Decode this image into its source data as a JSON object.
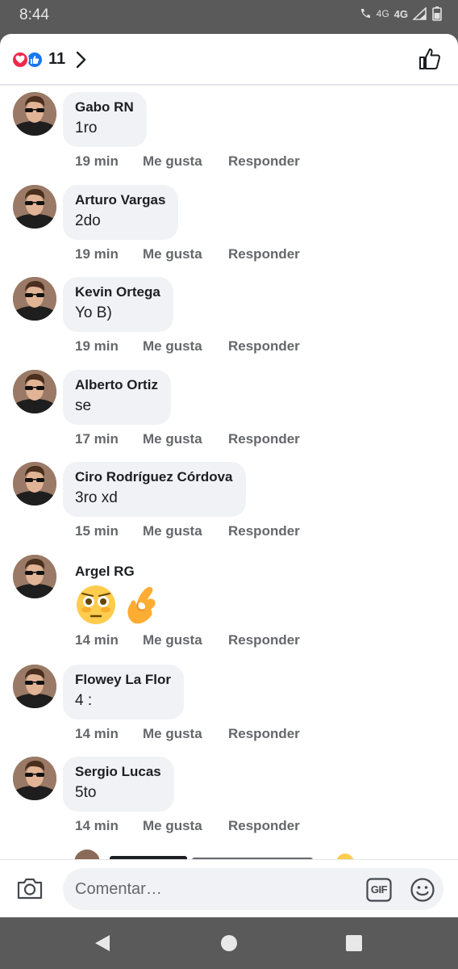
{
  "status": {
    "time": "8:44",
    "net1": "4G",
    "net2": "4G"
  },
  "header": {
    "reaction_count": "11"
  },
  "comments": [
    {
      "author": "Gabo RN",
      "text": "1ro",
      "time": "19 min",
      "like": "Me gusta",
      "reply": "Responder"
    },
    {
      "author": "Arturo Vargas",
      "text": "2do",
      "time": "19 min",
      "like": "Me gusta",
      "reply": "Responder"
    },
    {
      "author": "Kevin Ortega",
      "text": "Yo B)",
      "time": "19 min",
      "like": "Me gusta",
      "reply": "Responder"
    },
    {
      "author": "Alberto Ortiz",
      "text": "se",
      "time": "17 min",
      "like": "Me gusta",
      "reply": "Responder"
    },
    {
      "author": "Ciro Rodríguez Córdova",
      "text": "3ro xd",
      "time": "15 min",
      "like": "Me gusta",
      "reply": "Responder"
    },
    {
      "author": "Argel RG",
      "emojis": [
        "flushed-face",
        "ok-hand"
      ],
      "time": "14 min",
      "like": "Me gusta",
      "reply": "Responder"
    },
    {
      "author": "Flowey La Flor",
      "text": "4 :",
      "time": "14 min",
      "like": "Me gusta",
      "reply": "Responder"
    },
    {
      "author": "Sergio Lucas",
      "text": "5to",
      "time": "14 min",
      "like": "Me gusta",
      "reply": "Responder"
    }
  ],
  "composer": {
    "placeholder": "Comentar…",
    "gif_label": "GIF"
  },
  "colors": {
    "like_blue": "#1877f2",
    "love_red": "#f02849",
    "bubble_bg": "#f0f2f5",
    "meta_gray": "#65676b"
  }
}
